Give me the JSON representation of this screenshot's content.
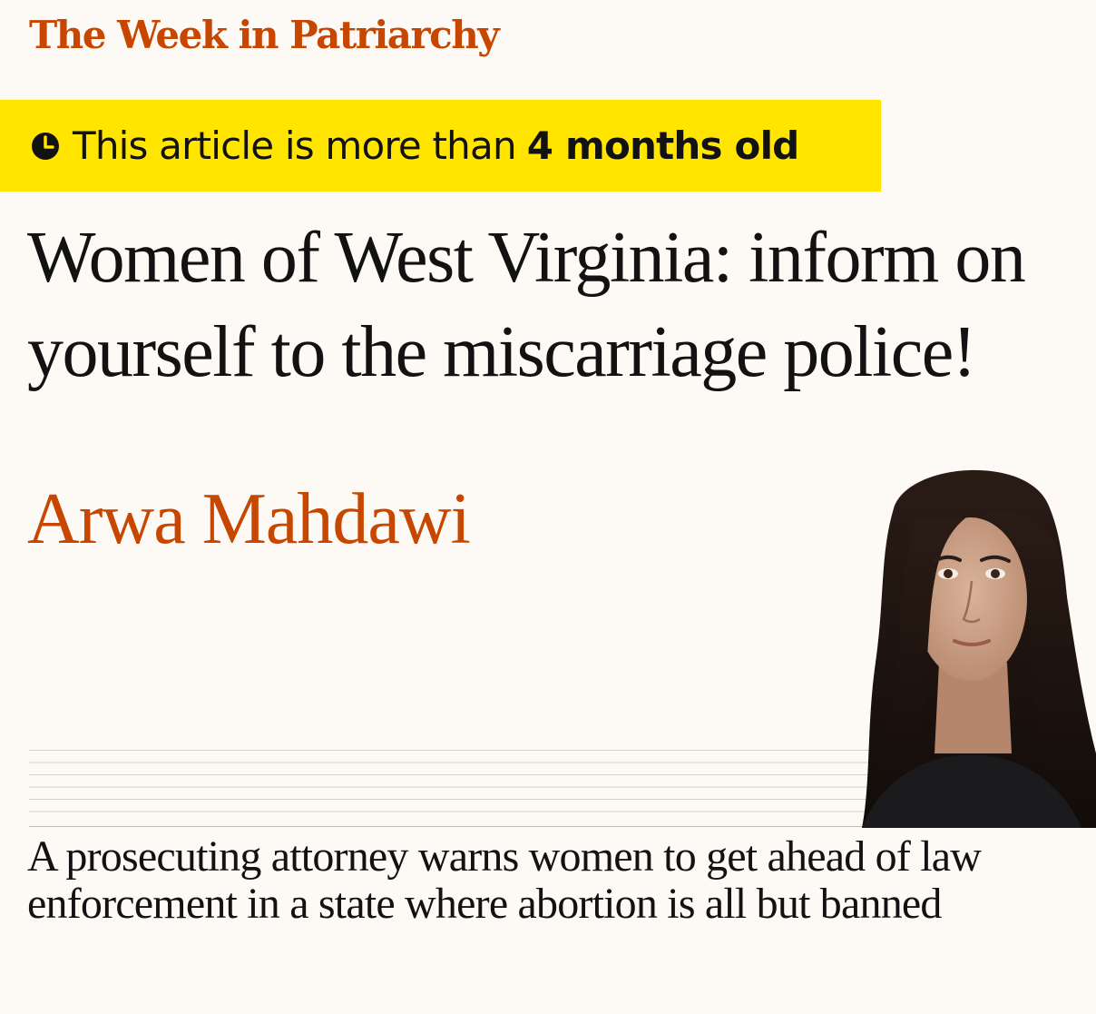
{
  "series": {
    "label": "The Week in Patriarchy",
    "color": "#c74600"
  },
  "age_warning": {
    "icon": "clock-icon",
    "prefix": "This article is more than",
    "age": "4 months old",
    "background": "#ffe500"
  },
  "article": {
    "headline": "Women of West Virginia: inform on yourself to the miscarriage police!",
    "author": "Arwa Mahdawi",
    "standfirst": "A prosecuting attorney warns women to get ahead of law enforcement in a state where abortion is all but banned"
  },
  "author_photo": {
    "icon": "author-portrait"
  },
  "colors": {
    "accent": "#c74600",
    "text": "#121212",
    "page_background": "#fdf9f5"
  }
}
